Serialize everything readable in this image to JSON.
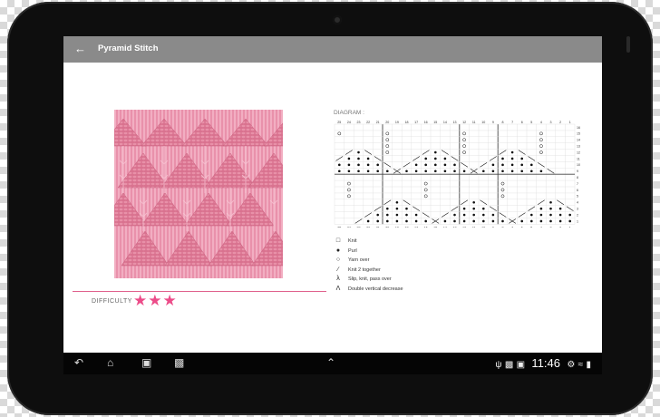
{
  "action_bar": {
    "title": "Pyramid Stitch",
    "back_icon": "arrow-left-icon"
  },
  "difficulty": {
    "label": "DIFFICULTY",
    "stars": 3,
    "max_stars": 3,
    "star_color": "#ec4c89"
  },
  "diagram": {
    "label": "DIAGRAM :",
    "column_numbers": [
      "25",
      "24",
      "23",
      "22",
      "21",
      "20",
      "19",
      "18",
      "17",
      "16",
      "15",
      "14",
      "13",
      "12",
      "11",
      "10",
      "9",
      "8",
      "7",
      "6",
      "5",
      "4",
      "3",
      "2",
      "1"
    ],
    "row_numbers": [
      "16",
      "15",
      "14",
      "13",
      "12",
      "11",
      "10",
      "9",
      "8",
      "7",
      "6",
      "5",
      "4",
      "3",
      "2",
      "1"
    ]
  },
  "legend": [
    {
      "icon": "empty-box",
      "text": "Knit"
    },
    {
      "icon": "dot",
      "text": "Purl"
    },
    {
      "icon": "circle",
      "text": "Yarn over"
    },
    {
      "icon": "slash",
      "text": "Knit 2 together"
    },
    {
      "icon": "backslash-lambda",
      "text": "Slip, knit, pass over"
    },
    {
      "icon": "double-decrease",
      "text": "Double vertical decrease"
    }
  ],
  "status_bar": {
    "time": "11:46"
  },
  "colors": {
    "action_bar": "#8a8a8a",
    "accent_pink": "#e0628d",
    "device": "#0e0e0e"
  }
}
